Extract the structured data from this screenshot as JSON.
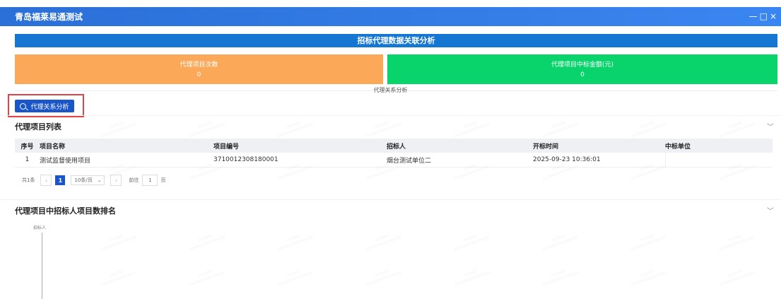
{
  "window": {
    "title": "青岛福莱易通测试",
    "controls": [
      "—",
      "□",
      "×"
    ]
  },
  "header_banner": "招标代理数据关联分析",
  "stats": [
    {
      "label": "代理项目次数",
      "value": "0",
      "color": "#fba959"
    },
    {
      "label": "代理项目中标金额(元)",
      "value": "0",
      "color": "#08d46b"
    }
  ],
  "relation_label": "代理关系分析",
  "analyze_button": "代理关系分析",
  "project_list": {
    "title": "代理项目列表",
    "columns": [
      "序号",
      "项目名称",
      "项目编号",
      "招标人",
      "开标时间",
      "中标单位"
    ],
    "rows": [
      [
        "1",
        "测试监督使用项目",
        "3710012308180001",
        "烟台测试单位二",
        "2025-09-23 10:36:01",
        ""
      ]
    ]
  },
  "pagination": {
    "total": "共1条",
    "current_page": "1",
    "page_size": "10条/页",
    "goto_label": "前往",
    "goto_value": "1",
    "page_unit": "页"
  },
  "ranking": {
    "title": "代理项目中招标人项目数排名",
    "ylabel": "招标人"
  },
  "colors": {
    "primary": "#1b56c9",
    "banner": "#1677d2",
    "highlight_border": "#e04545"
  }
}
